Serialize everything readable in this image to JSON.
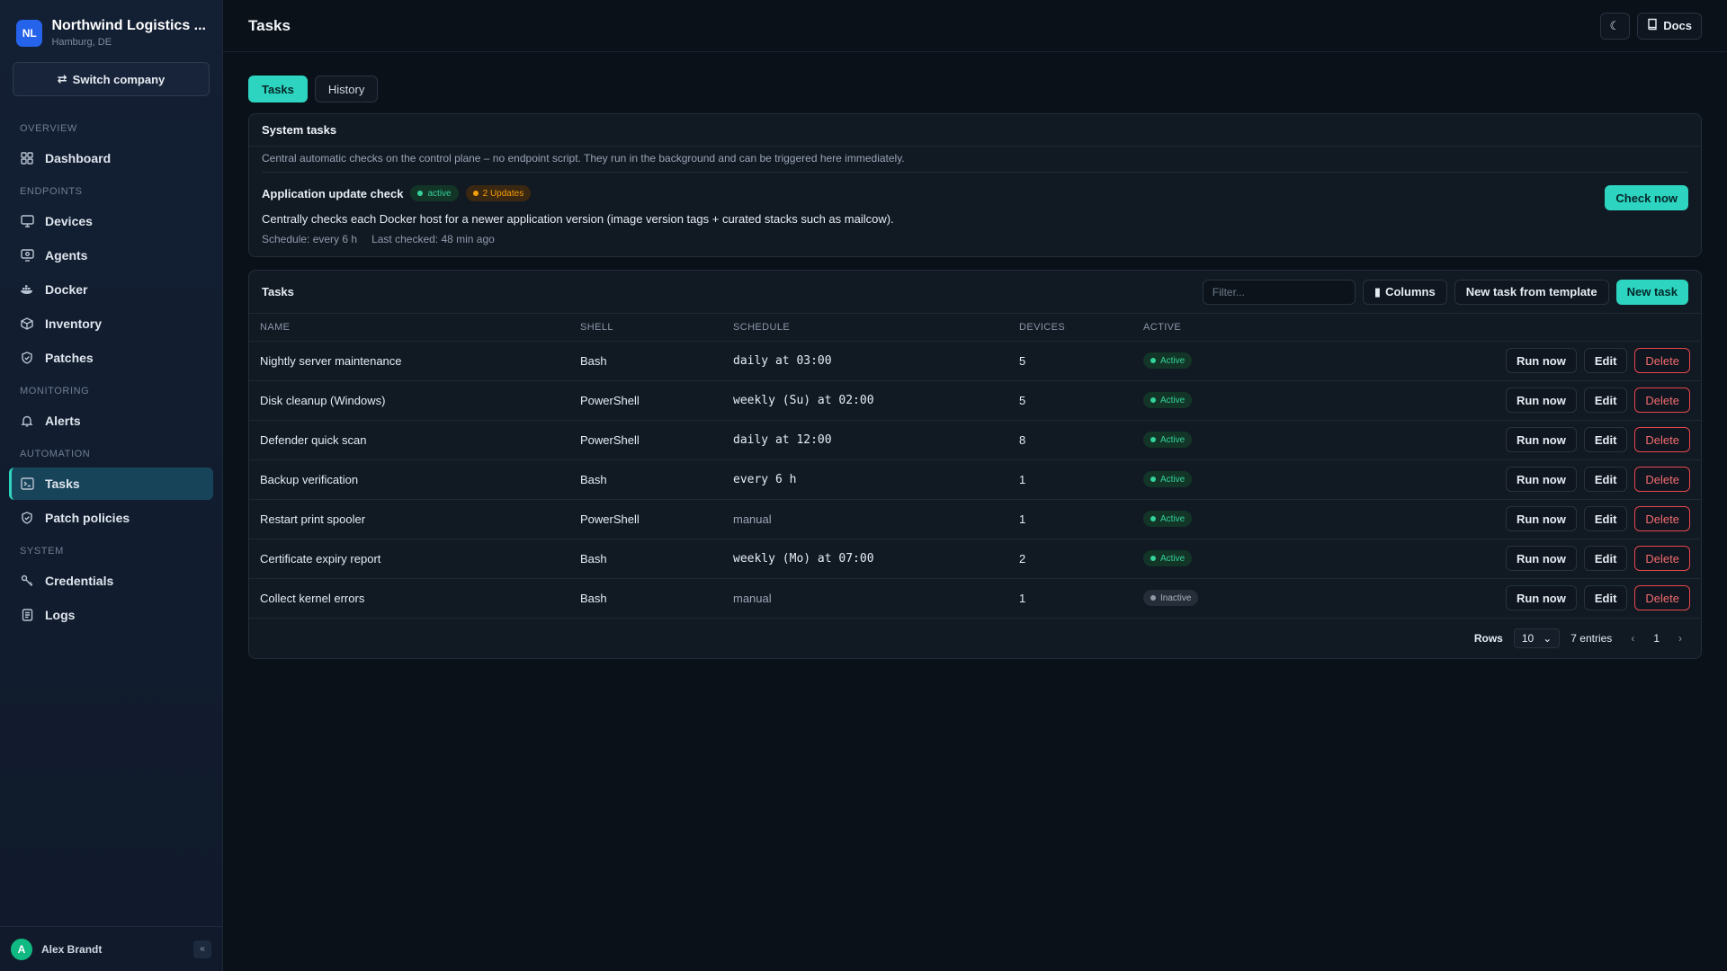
{
  "company": {
    "initials": "NL",
    "name": "Northwind Logistics ...",
    "location": "Hamburg, DE"
  },
  "switch_company_label": "Switch company",
  "nav": {
    "overview_label": "OVERVIEW",
    "dashboard": "Dashboard",
    "endpoints_label": "ENDPOINTS",
    "devices": "Devices",
    "agents": "Agents",
    "docker": "Docker",
    "inventory": "Inventory",
    "patches": "Patches",
    "monitoring_label": "MONITORING",
    "alerts": "Alerts",
    "automation_label": "AUTOMATION",
    "tasks": "Tasks",
    "patch_policies": "Patch policies",
    "system_label": "SYSTEM",
    "credentials": "Credentials",
    "logs": "Logs"
  },
  "user": {
    "initial": "A",
    "name": "Alex Brandt"
  },
  "header": {
    "title": "Tasks",
    "docs_label": "Docs"
  },
  "tabs": {
    "tasks": "Tasks",
    "history": "History"
  },
  "system_tasks": {
    "title": "System tasks",
    "description": "Central automatic checks on the control plane – no endpoint script. They run in the background and can be triggered here immediately.",
    "task": {
      "name": "Application update check",
      "status": "active",
      "updates": "2 Updates",
      "description": "Centrally checks each Docker host for a newer application version (image version tags + curated stacks such as mailcow).",
      "schedule": "Schedule: every 6 h",
      "last_checked": "Last checked: 48 min ago",
      "check_now": "Check now"
    }
  },
  "tasks_table": {
    "title": "Tasks",
    "filter_placeholder": "Filter...",
    "columns_label": "Columns",
    "new_from_template": "New task from template",
    "new_task": "New task",
    "headers": [
      "NAME",
      "SHELL",
      "SCHEDULE",
      "DEVICES",
      "ACTIVE"
    ],
    "actions": {
      "run": "Run now",
      "edit": "Edit",
      "delete": "Delete"
    },
    "rows": [
      {
        "name": "Nightly server maintenance",
        "shell": "Bash",
        "schedule": "daily at 03:00",
        "schedule_mono": true,
        "devices": "5",
        "active": "Active"
      },
      {
        "name": "Disk cleanup (Windows)",
        "shell": "PowerShell",
        "schedule": "weekly (Su) at 02:00",
        "schedule_mono": true,
        "devices": "5",
        "active": "Active"
      },
      {
        "name": "Defender quick scan",
        "shell": "PowerShell",
        "schedule": "daily at 12:00",
        "schedule_mono": true,
        "devices": "8",
        "active": "Active"
      },
      {
        "name": "Backup verification",
        "shell": "Bash",
        "schedule": "every 6 h",
        "schedule_mono": true,
        "devices": "1",
        "active": "Active"
      },
      {
        "name": "Restart print spooler",
        "shell": "PowerShell",
        "schedule": "manual",
        "schedule_mono": false,
        "devices": "1",
        "active": "Active"
      },
      {
        "name": "Certificate expiry report",
        "shell": "Bash",
        "schedule": "weekly (Mo) at 07:00",
        "schedule_mono": true,
        "devices": "2",
        "active": "Active"
      },
      {
        "name": "Collect kernel errors",
        "shell": "Bash",
        "schedule": "manual",
        "schedule_mono": false,
        "devices": "1",
        "active": "Inactive"
      }
    ],
    "pager": {
      "rows_label": "Rows",
      "rows_value": "10",
      "entries": "7 entries",
      "page": "1"
    }
  },
  "colors": {
    "accent": "#2dd4bf",
    "danger": "#e5484d",
    "success": "#34d399",
    "warning": "#f59e0b"
  }
}
